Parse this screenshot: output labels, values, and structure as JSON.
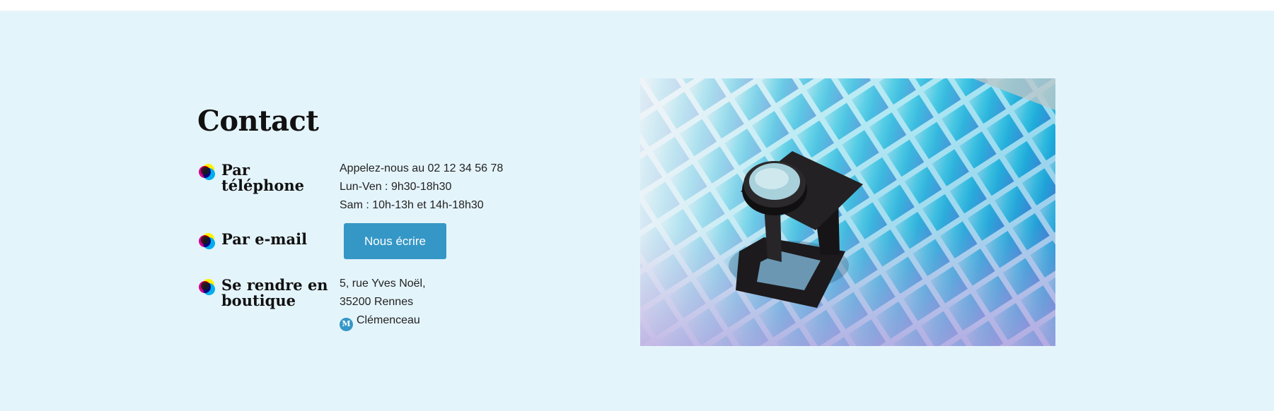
{
  "contact": {
    "title": "Contact",
    "phone": {
      "label": "Par téléphone",
      "lines": [
        "Appelez-nous au 02 12 34 56 78",
        "Lun-Ven : 9h30-18h30",
        "Sam : 10h-13h et 14h-18h30"
      ]
    },
    "email": {
      "label": "Par e-mail",
      "button_label": "Nous écrire"
    },
    "shop": {
      "label_line1": "Se rendre en",
      "label_line2": "boutique",
      "address_line1": "5, rue Yves Noël,",
      "address_line2": "35200 Rennes",
      "metro_badge": "M",
      "metro_station": "Clémenceau"
    }
  },
  "icons": {
    "bullet": "cmyk-dots-icon",
    "metro": "metro-icon"
  },
  "colors": {
    "section_background": "#e4f4fb",
    "button": "#3597c6",
    "metro_badge": "#3597c6",
    "cyan": "#00aeef",
    "magenta": "#ec008c",
    "yellow": "#fff200"
  },
  "image": {
    "subject": "photo"
  }
}
